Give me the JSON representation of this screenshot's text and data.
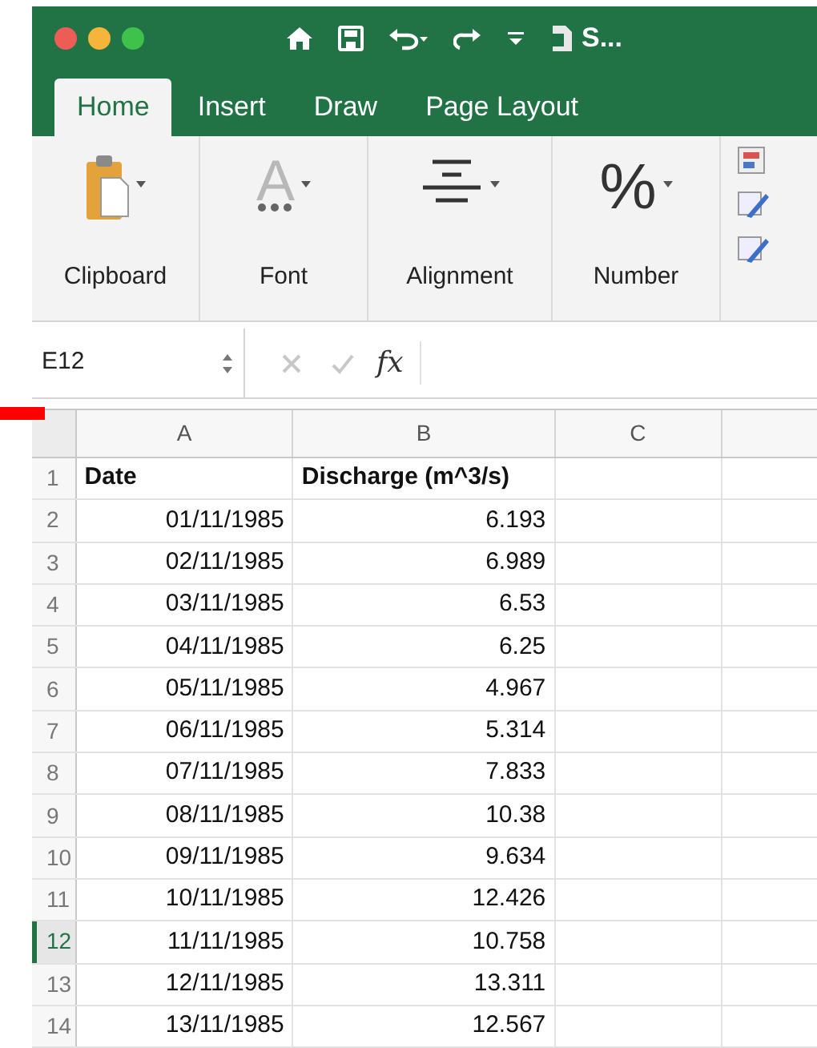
{
  "window": {
    "title": "S..."
  },
  "tabs": [
    {
      "label": "Home",
      "selected": true
    },
    {
      "label": "Insert",
      "selected": false
    },
    {
      "label": "Draw",
      "selected": false
    },
    {
      "label": "Page Layout",
      "selected": false
    }
  ],
  "ribbon_groups": [
    {
      "kind": "clipboard",
      "label": "Clipboard"
    },
    {
      "kind": "font",
      "label": "Font",
      "glyph": "A"
    },
    {
      "kind": "alignment",
      "label": "Alignment"
    },
    {
      "kind": "number",
      "label": "Number",
      "glyph": "%"
    }
  ],
  "name_box": {
    "value": "E12"
  },
  "formula_bar": {
    "function_label": "fx"
  },
  "sheet": {
    "columns": [
      "A",
      "B",
      "C"
    ],
    "rows": [
      {
        "number": "1",
        "selected": false,
        "kind": "header",
        "cells": [
          "Date",
          "Discharge (m^3/s)"
        ]
      },
      {
        "number": "2",
        "selected": false,
        "kind": "data",
        "cells": [
          "01/11/1985",
          "6.193"
        ]
      },
      {
        "number": "3",
        "selected": false,
        "kind": "data",
        "cells": [
          "02/11/1985",
          "6.989"
        ]
      },
      {
        "number": "4",
        "selected": false,
        "kind": "data",
        "cells": [
          "03/11/1985",
          "6.53"
        ]
      },
      {
        "number": "5",
        "selected": false,
        "kind": "data",
        "cells": [
          "04/11/1985",
          "6.25"
        ]
      },
      {
        "number": "6",
        "selected": false,
        "kind": "data",
        "cells": [
          "05/11/1985",
          "4.967"
        ]
      },
      {
        "number": "7",
        "selected": false,
        "kind": "data",
        "cells": [
          "06/11/1985",
          "5.314"
        ]
      },
      {
        "number": "8",
        "selected": false,
        "kind": "data",
        "cells": [
          "07/11/1985",
          "7.833"
        ]
      },
      {
        "number": "9",
        "selected": false,
        "kind": "data",
        "cells": [
          "08/11/1985",
          "10.38"
        ]
      },
      {
        "number": "10",
        "selected": false,
        "kind": "data",
        "cells": [
          "09/11/1985",
          "9.634"
        ]
      },
      {
        "number": "11",
        "selected": false,
        "kind": "data",
        "cells": [
          "10/11/1985",
          "12.426"
        ]
      },
      {
        "number": "12",
        "selected": true,
        "kind": "data",
        "cells": [
          "11/11/1985",
          "10.758"
        ]
      },
      {
        "number": "13",
        "selected": false,
        "kind": "data",
        "cells": [
          "12/11/1985",
          "13.311"
        ]
      },
      {
        "number": "14",
        "selected": false,
        "kind": "data",
        "cells": [
          "13/11/1985",
          "12.567"
        ]
      }
    ]
  }
}
